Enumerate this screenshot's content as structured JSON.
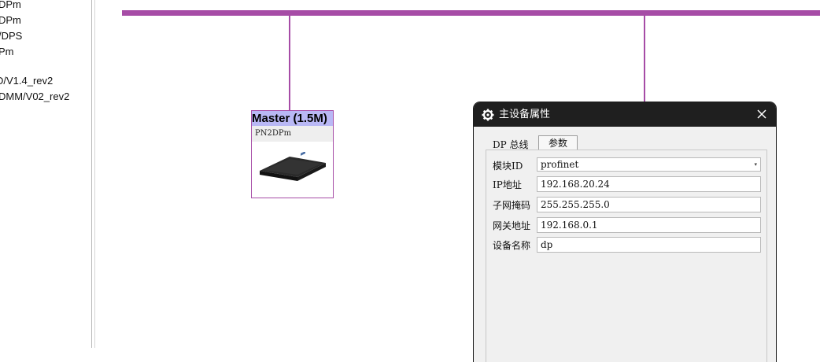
{
  "tree": {
    "items": [
      "DPm",
      "DPm",
      "/DPS",
      "Pm",
      "D/V1.4_rev2",
      "DMM/V02_rev2"
    ]
  },
  "canvas": {
    "master": {
      "title": "Master (1.5M)",
      "model": "PN2DPm"
    }
  },
  "dialog": {
    "title": "主设备属性",
    "tabs": {
      "bus": "DP 总线",
      "params": "参数"
    },
    "fields": {
      "module_id": {
        "label": "模块ID",
        "value": "profinet"
      },
      "ip": {
        "label": "IP地址",
        "value": "192.168.20.24"
      },
      "subnet": {
        "label": "子网掩码",
        "value": "255.255.255.0"
      },
      "gateway": {
        "label": "网关地址",
        "value": "192.168.0.1"
      },
      "device_name": {
        "label": "设备名称",
        "value": "dp"
      }
    }
  },
  "colors": {
    "bus": "#a64ca6",
    "master_title_bg": "#b9b8f5",
    "dialog_titlebar": "#1f1f1f"
  }
}
